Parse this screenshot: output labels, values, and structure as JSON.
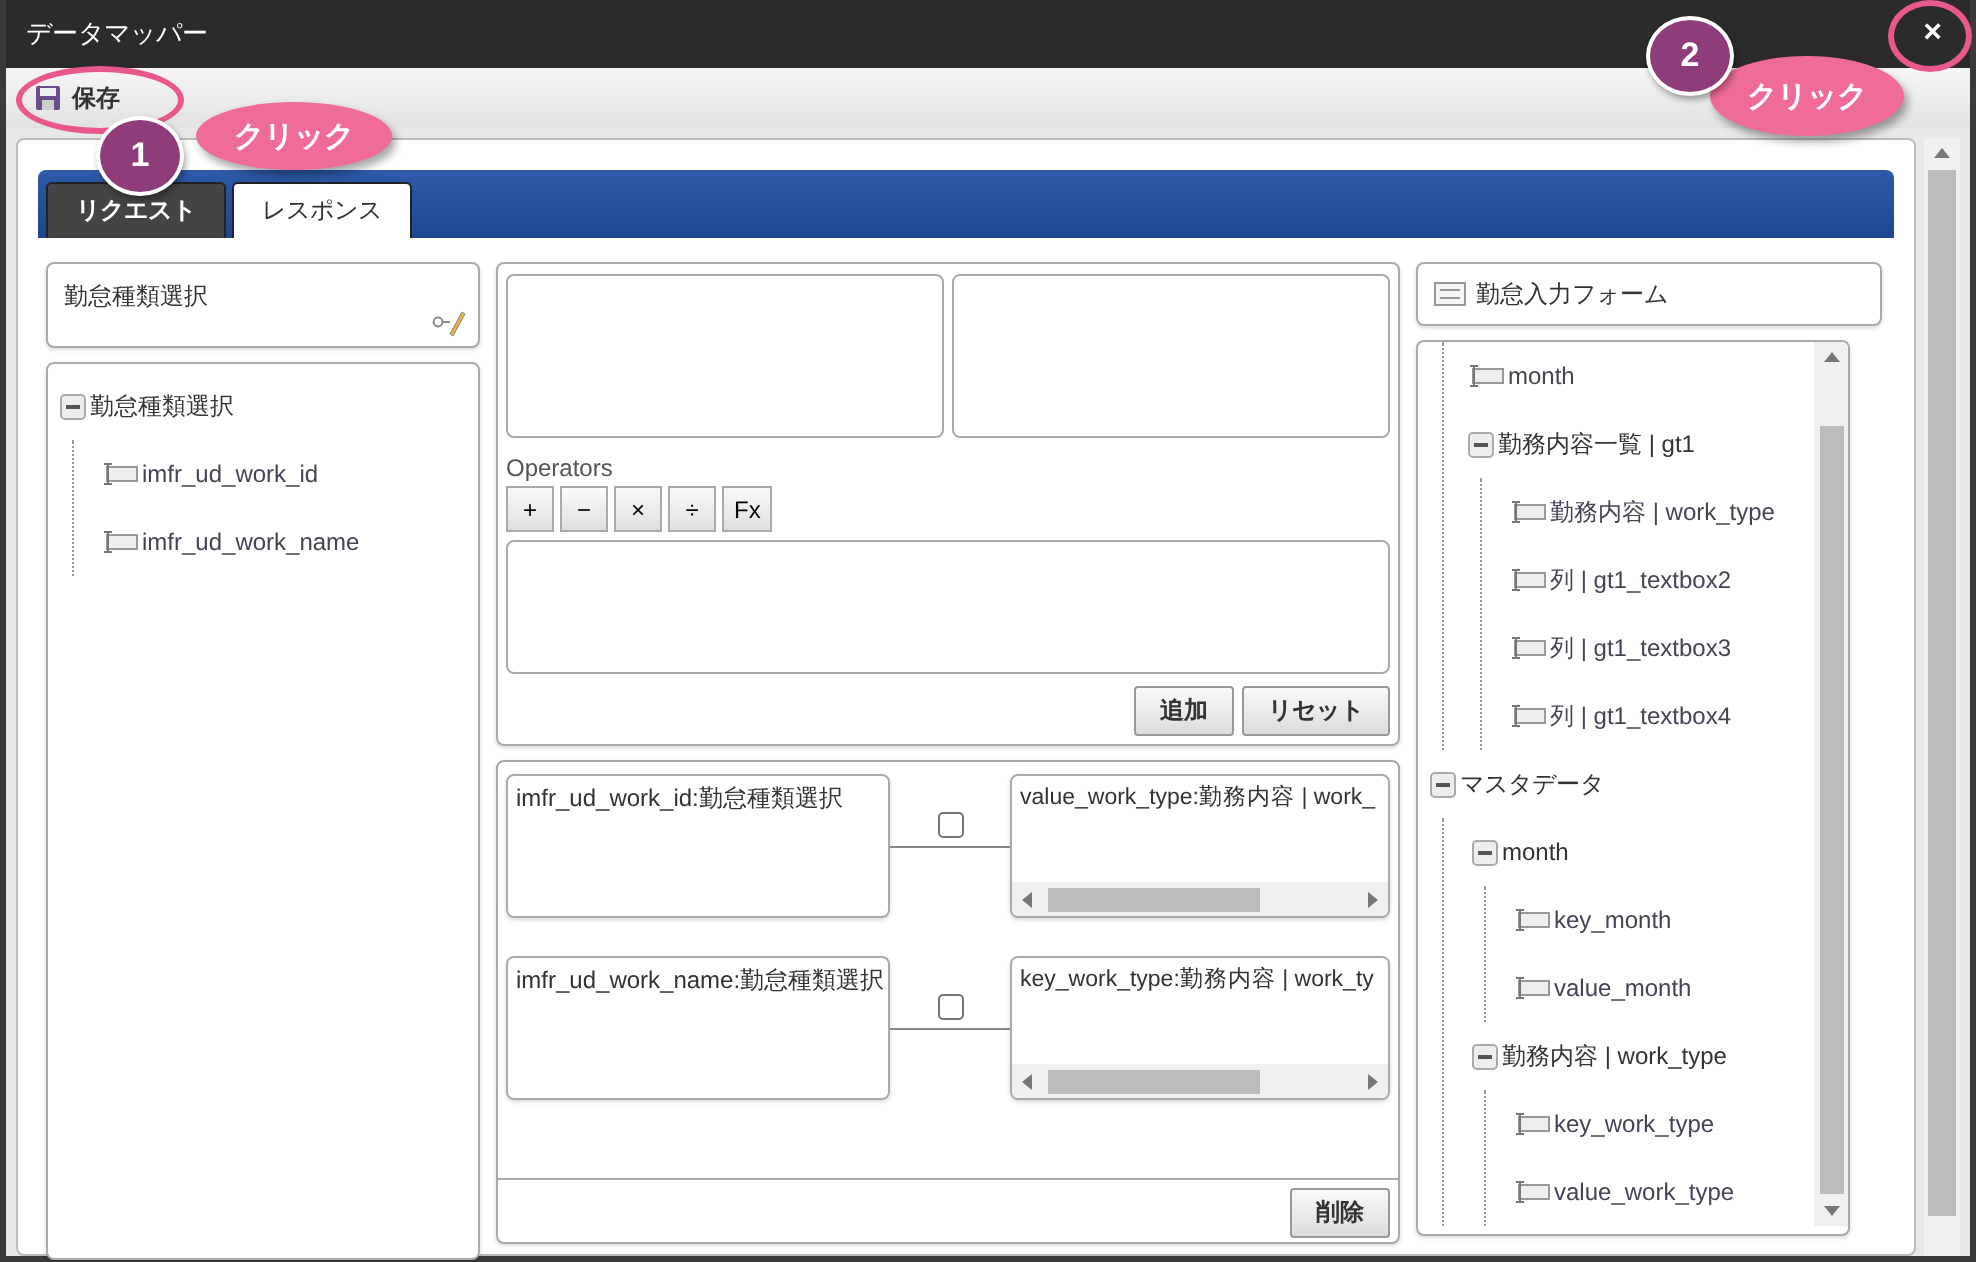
{
  "window": {
    "title": "データマッパー",
    "close": "×"
  },
  "toolbar": {
    "save": "保存"
  },
  "tabs": [
    {
      "label": "リクエスト",
      "selected": false
    },
    {
      "label": "レスポンス",
      "selected": true
    }
  ],
  "source": {
    "header": "勤怠種類選択",
    "tree": [
      {
        "label": "勤怠種類選択",
        "expanded": true,
        "children": [
          {
            "label": "imfr_ud_work_id"
          },
          {
            "label": "imfr_ud_work_name"
          }
        ]
      }
    ]
  },
  "expression": {
    "operators_label": "Operators",
    "operators": [
      "+",
      "−",
      "×",
      "÷",
      "Fx"
    ],
    "buttons": [
      "追加",
      "リセット"
    ]
  },
  "mappings": {
    "rows": [
      {
        "source": "imfr_ud_work_id:勤怠種類選択",
        "checked": false,
        "target": "value_work_type:勤務内容 | work_"
      },
      {
        "source": "imfr_ud_work_name:勤怠種類選択",
        "checked": false,
        "target": "key_work_type:勤務内容 | work_ty"
      }
    ],
    "delete": "削除"
  },
  "target": {
    "header": "勤怠入力フォーム",
    "tree": [
      {
        "kind": "hidden",
        "children": [
          {
            "label": "month"
          },
          {
            "label": "勤務内容一覧 | gt1",
            "expanded": true,
            "children": [
              {
                "label": "勤務内容 | work_type"
              },
              {
                "label": "列 | gt1_textbox2"
              },
              {
                "label": "列 | gt1_textbox3"
              },
              {
                "label": "列 | gt1_textbox4"
              }
            ]
          }
        ]
      },
      {
        "label": "マスタデータ",
        "expanded": true,
        "children": [
          {
            "label": "month",
            "expanded": true,
            "children": [
              {
                "label": "key_month"
              },
              {
                "label": "value_month"
              }
            ]
          },
          {
            "label": "勤務内容 | work_type",
            "expanded": true,
            "children": [
              {
                "label": "key_work_type"
              },
              {
                "label": "value_work_type"
              }
            ]
          }
        ]
      }
    ]
  },
  "annotations": [
    {
      "number": "1",
      "text": "クリック"
    },
    {
      "number": "2",
      "text": "クリック"
    }
  ]
}
